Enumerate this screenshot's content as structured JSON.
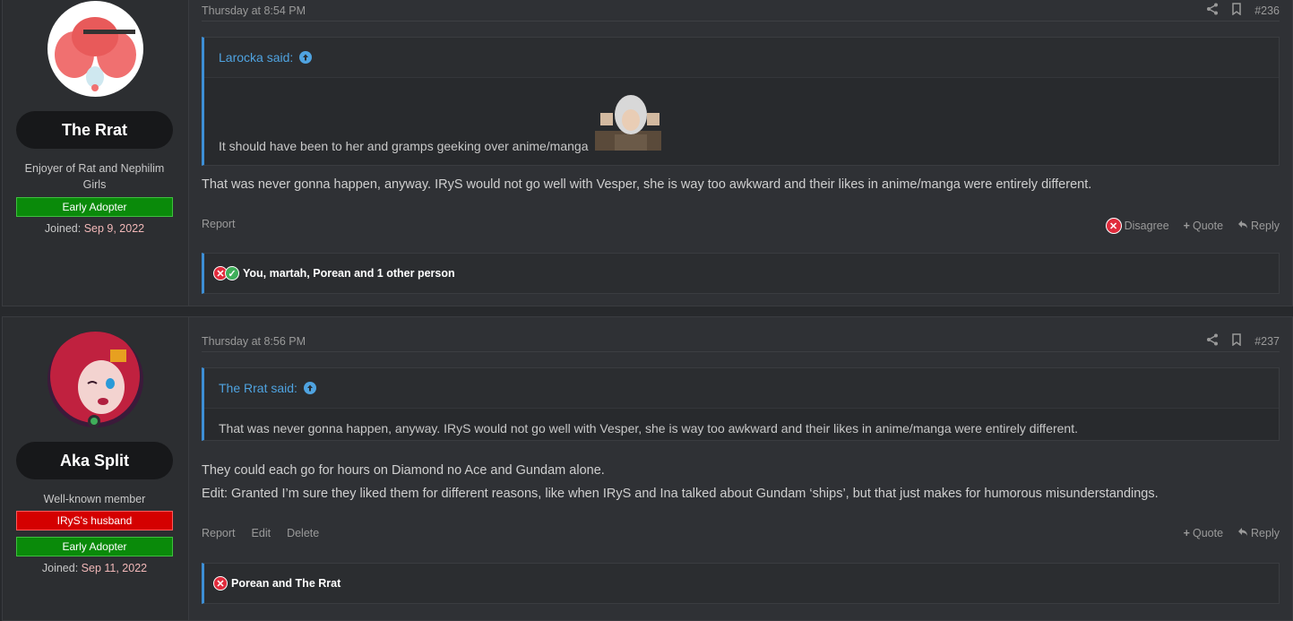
{
  "posts": [
    {
      "user": {
        "name": "The Rrat",
        "title": "Enjoyer of Rat and Nephilim Girls",
        "banners": [
          "Early Adopter"
        ],
        "joined_label": "Joined:",
        "joined_date": "Sep 9, 2022"
      },
      "time": "Thursday at 8:54 PM",
      "number": "#236",
      "quote": {
        "author": "Larocka said:",
        "text": "It should have been to her and gramps geeking over anime/manga"
      },
      "body": [
        "That was never gonna happen, anyway. IRyS would not go well with Vesper, she is way too awkward and their likes in anime/manga were entirely different."
      ],
      "actions_left": [
        "Report"
      ],
      "actions_right": {
        "disagree": "Disagree",
        "quote": "Quote",
        "reply": "Reply"
      },
      "reactions": "You, martah, Porean and 1 other person"
    },
    {
      "user": {
        "name": "Aka Split",
        "title": "Well-known member",
        "banners": [
          "IRyS's husband",
          "Early Adopter"
        ],
        "joined_label": "Joined:",
        "joined_date": "Sep 11, 2022"
      },
      "time": "Thursday at 8:56 PM",
      "number": "#237",
      "quote": {
        "author": "The Rrat said:",
        "text": "That was never gonna happen, anyway. IRyS would not go well with Vesper, she is way too awkward and their likes in anime/manga were entirely different."
      },
      "body": [
        "They could each go for hours on Diamond no Ace and Gundam alone.",
        "Edit: Granted I’m sure they liked them for different reasons, like when IRyS and Ina talked about Gundam ‘ships’, but that just makes for humorous misunderstandings."
      ],
      "actions_left": [
        "Report",
        "Edit",
        "Delete"
      ],
      "actions_right": {
        "quote": "Quote",
        "reply": "Reply"
      },
      "reactions": "Porean and The Rrat"
    }
  ],
  "colors": {
    "accent": "#3d8fd6",
    "banner_green": "#0a8a0a",
    "banner_red": "#d40000",
    "disagree_red": "#e02b3c"
  },
  "icons": [
    "share-icon",
    "bookmark-icon",
    "arrow-up-circle-icon",
    "disagree-icon",
    "agree-icon",
    "plus-icon",
    "reply-icon",
    "online-icon"
  ]
}
